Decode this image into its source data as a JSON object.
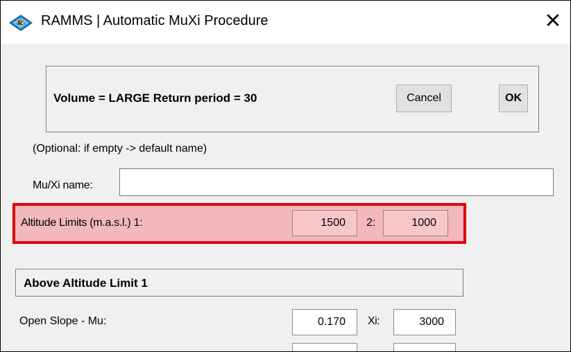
{
  "window": {
    "title": "RAMMS | Automatic MuXi Procedure",
    "close_symbol": "✕"
  },
  "summary_panel": {
    "text": "Volume = LARGE  Return period = 30",
    "cancel_label": "Cancel",
    "ok_label": "OK"
  },
  "name_section": {
    "hint": "(Optional: if empty -> default name)",
    "label": "Mu/Xi name:",
    "value": ""
  },
  "altitude": {
    "label": "Altitude Limits (m.a.s.l.) 1:",
    "limit1": "1500",
    "limit2_label": "2:",
    "limit2": "1000",
    "highlight_color": "#e0000d"
  },
  "above_limit": {
    "title": "Above Altitude Limit 1",
    "open_slope_label": "Open Slope - Mu:",
    "mu_value": "0.170",
    "xi_label": "Xi:",
    "xi_value": "3000"
  }
}
